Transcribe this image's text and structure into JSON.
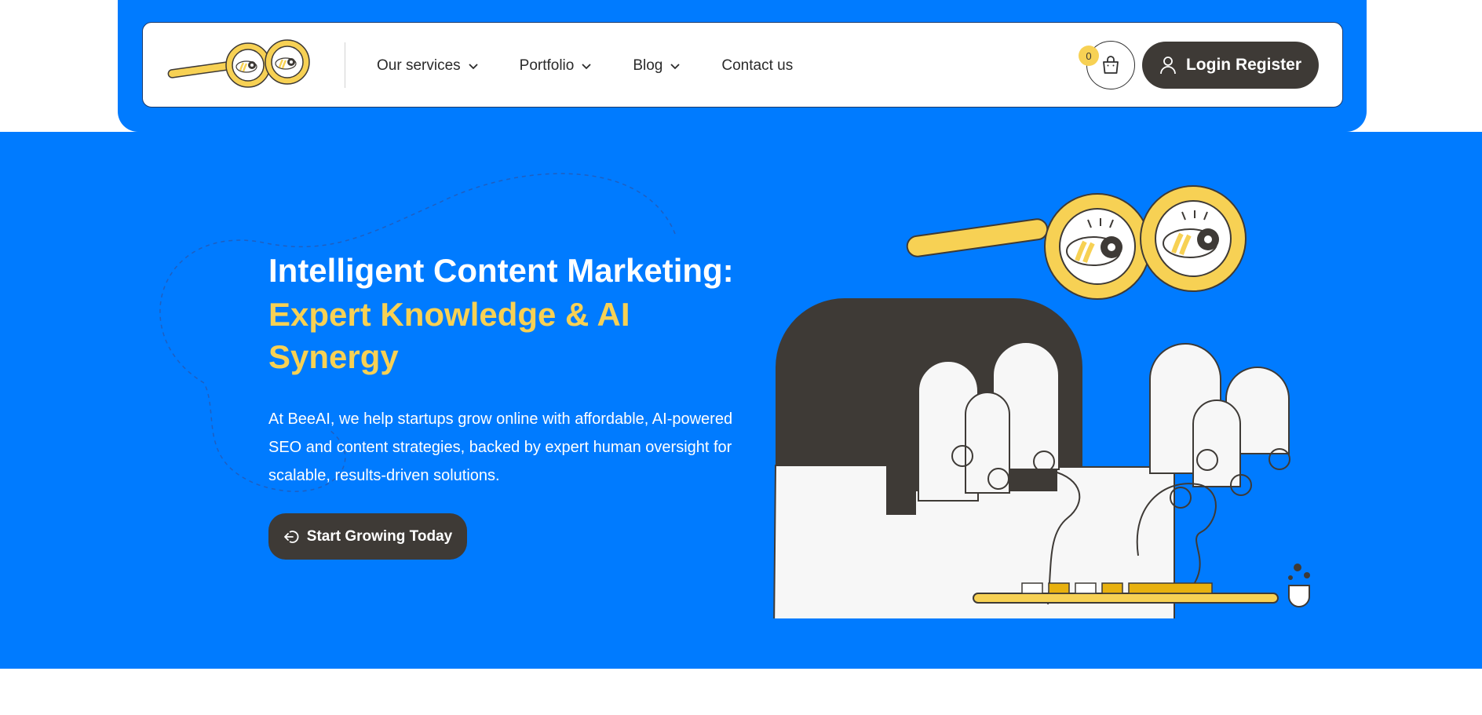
{
  "brand": {
    "logo_icon": "binocular-eyes-logo",
    "colors": {
      "primary_blue": "#007bff",
      "accent_yellow": "#f7d154",
      "dark": "#3e3a36",
      "white": "#ffffff"
    }
  },
  "header": {
    "nav": [
      {
        "label": "Our services",
        "has_dropdown": true
      },
      {
        "label": "Portfolio",
        "has_dropdown": true
      },
      {
        "label": "Blog",
        "has_dropdown": true
      },
      {
        "label": "Contact us",
        "has_dropdown": false
      }
    ],
    "cart": {
      "icon": "shopping-bag-icon",
      "count": "0"
    },
    "login": {
      "icon": "user-icon",
      "label": "Login Register"
    }
  },
  "hero": {
    "title": "Intelligent Content Marketing:",
    "subtitle": "Expert Knowledge & AI Synergy",
    "description": "At BeeAI, we help startups grow online with affordable, AI-powered SEO and content strategies, backed by expert human oversight for scalable, results-driven solutions.",
    "cta": {
      "icon": "sign-in-arrow-icon",
      "label": "Start Growing Today"
    },
    "illustration": "hands-typing-on-keyboard-with-magnifier-eyes"
  }
}
